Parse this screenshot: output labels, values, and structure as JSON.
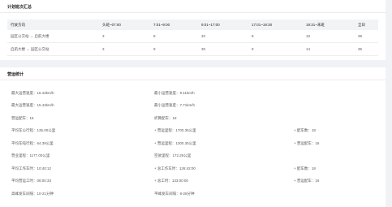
{
  "schedule": {
    "title": "计划班次汇总",
    "headers": [
      "行驶方向",
      "头班~07:00",
      "7:01~9:00",
      "9:01~17:00",
      "17:01~19:30",
      "19:31~末班",
      "全日"
    ],
    "rows": [
      [
        "园区公交站 → 启航大楼",
        "3",
        "8",
        "32",
        "8",
        "10",
        "39"
      ],
      [
        "启航大楼 → 园区公交站",
        "3",
        "9",
        "30",
        "9",
        "14",
        "35"
      ]
    ]
  },
  "ops": {
    "title": "营运统计",
    "rows": [
      [
        "最大运营速度：15.43km/h",
        "最小运营速度：9.11km/h",
        ""
      ],
      [
        "最大运营速度：15.43km/h",
        "最小运营速度：7.71km/h",
        ""
      ],
      [
        "营运配车：16",
        "折算配车：18",
        ""
      ],
      [
        "平均车公行程：135.00公里",
        "+ 营运里程：1700.35公里",
        "+ 配车数：18"
      ],
      [
        "平均车吨行程：64.39公里",
        "+ 营运里程：1300.35公里",
        "+ 营运配车：16"
      ],
      [
        "营业里程：1177.00公里",
        "空驶里程：172.25公里",
        ""
      ],
      [
        "平均工作车时：10:40:12",
        "+ 总工作车时：126:42:00",
        "+ 配车数：18"
      ],
      [
        "平均营运工时：08:00:33",
        "+ 总工时：133:00:00",
        "+ 营运配车：16"
      ],
      [
        "高峰发车间隔：10-21分钟",
        "平峰发车间隔：8-28分钟",
        ""
      ]
    ]
  }
}
